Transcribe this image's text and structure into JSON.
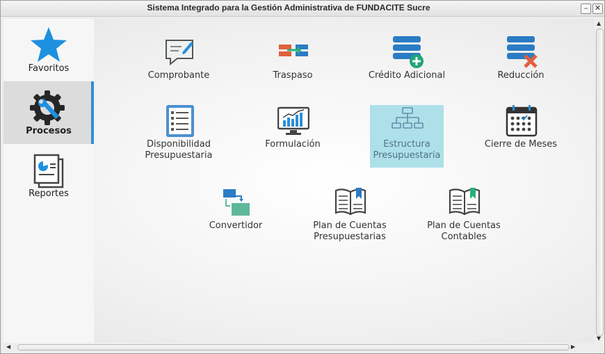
{
  "window": {
    "title": "Sistema Integrado para la Gestión Administrativa de FUNDACITE Sucre",
    "minimize": "–",
    "close": "✕"
  },
  "sidebar": {
    "items": [
      {
        "label": "Favoritos",
        "icon": "star-icon"
      },
      {
        "label": "Procesos",
        "icon": "gear-wrench-icon",
        "active": true
      },
      {
        "label": "Reportes",
        "icon": "report-icon"
      }
    ]
  },
  "tiles": [
    {
      "label": "Comprobante",
      "icon": "voucher-icon"
    },
    {
      "label": "Traspaso",
      "icon": "transfer-icon"
    },
    {
      "label": "Crédito Adicional",
      "icon": "database-add-icon"
    },
    {
      "label": "Reducción",
      "icon": "database-remove-icon"
    },
    {
      "label": "Disponibilidad\nPresupuestaria",
      "icon": "list-icon"
    },
    {
      "label": "Formulación",
      "icon": "monitor-chart-icon"
    },
    {
      "label": "Estructura\nPresupuestaria",
      "icon": "hierarchy-icon",
      "selected": true
    },
    {
      "label": "Cierre de Meses",
      "icon": "calendar-icon"
    },
    {
      "label": "Convertidor",
      "icon": "convert-icon"
    },
    {
      "label": "Plan de Cuentas\nPresupuestarias",
      "icon": "book-blue-icon"
    },
    {
      "label": "Plan de Cuentas\nContables",
      "icon": "book-green-icon"
    }
  ],
  "colors": {
    "accent": "#2b8fd6",
    "selected_bg": "#aee0ea"
  }
}
